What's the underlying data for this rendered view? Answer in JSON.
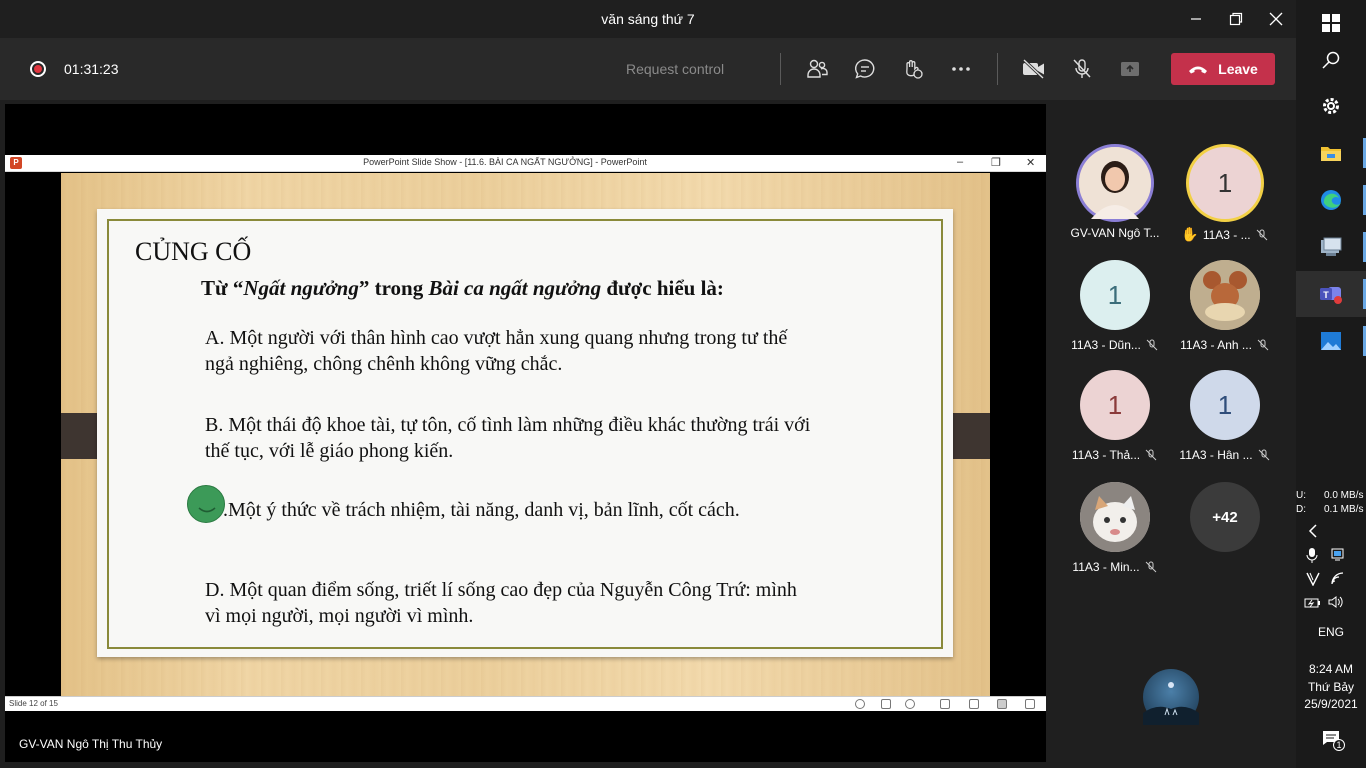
{
  "window": {
    "title": "văn sáng thứ 7"
  },
  "toolbar": {
    "timer": "01:31:23",
    "request_control": "Request control",
    "leave_label": "Leave",
    "icons": [
      "people-icon",
      "chat-icon",
      "reactions-icon",
      "more-icon",
      "camera-off-icon",
      "mic-off-icon",
      "share-icon"
    ]
  },
  "powerpoint": {
    "title": "PowerPoint Slide Show - [11.6. BÀI CA NGẤT NGƯỞNG] - PowerPoint",
    "status": "Slide 12 of 15",
    "slide": {
      "heading": "CỦNG CỐ",
      "q_prefix": "Từ “",
      "q_term": "Ngất ngưởng",
      "q_mid": "” trong ",
      "q_work": "Bài ca ngất ngưởng",
      "q_suffix": " được hiểu là:",
      "option_a_1": "A. Một người với thân hình cao vượt hẳn xung quang nhưng trong tư thế",
      "option_a_2": "ngả nghiêng, chông chênh không vững chắc.",
      "option_b_1": "B. Một thái độ khoe tài, tự tôn, cố tình làm những điều khác thường trái với",
      "option_b_2": "thế tục, với lễ giáo phong kiến.",
      "option_c_1": ".Một ý thức về trách nhiệm, tài năng, danh vị, bản lĩnh, cốt cách.",
      "option_d_1": "D. Một quan điểm sống, triết lí sống cao đẹp của Nguyễn Công Trứ: mình",
      "option_d_2": "vì mọi người, mọi người vì mình."
    }
  },
  "presenter": {
    "name": "GV-VAN Ngô Thị Thu Thủy"
  },
  "participants": [
    {
      "label": "GV-VAN Ngô T...",
      "initial": "",
      "bg": "#e8c9b8",
      "ring": "#8b7fd6",
      "hand": false,
      "muted": false
    },
    {
      "label": "11A3 - ...",
      "initial": "1",
      "bg": "#ecd3d3",
      "ring": "#f2d045",
      "hand": true,
      "muted": true
    },
    {
      "label": "11A3 - Dũn...",
      "initial": "1",
      "bg": "#dcefef",
      "ring": "",
      "hand": false,
      "muted": true
    },
    {
      "label": "11A3 - Anh ...",
      "initial": "",
      "bg": "#c9b79a",
      "ring": "",
      "hand": false,
      "muted": true
    },
    {
      "label": "11A3 - Thả...",
      "initial": "1",
      "bg": "#ecd3d3",
      "ring": "",
      "hand": false,
      "muted": true
    },
    {
      "label": "11A3 - Hân ...",
      "initial": "1",
      "bg": "#cfd9ea",
      "ring": "",
      "hand": false,
      "muted": true
    },
    {
      "label": "11A3 - Min...",
      "initial": "",
      "bg": "#d9d4cf",
      "ring": "",
      "hand": false,
      "muted": true
    },
    {
      "label": "",
      "initial": "+42",
      "bg": "#3b3b3b",
      "ring": "",
      "hand": false,
      "muted": false
    }
  ],
  "taskbar": {
    "net_up_label": "U:",
    "net_up": "0.0 MB/s",
    "net_down_label": "D:",
    "net_down": "0.1 MB/s",
    "lang": "ENG",
    "time": "8:24 AM",
    "day": "Thứ Bảy",
    "date": "25/9/2021",
    "notifications": "1"
  },
  "colors": {
    "leave": "#c4314b",
    "raised_ring": "#f2d045",
    "presenter_ring": "#8b7fd6"
  }
}
